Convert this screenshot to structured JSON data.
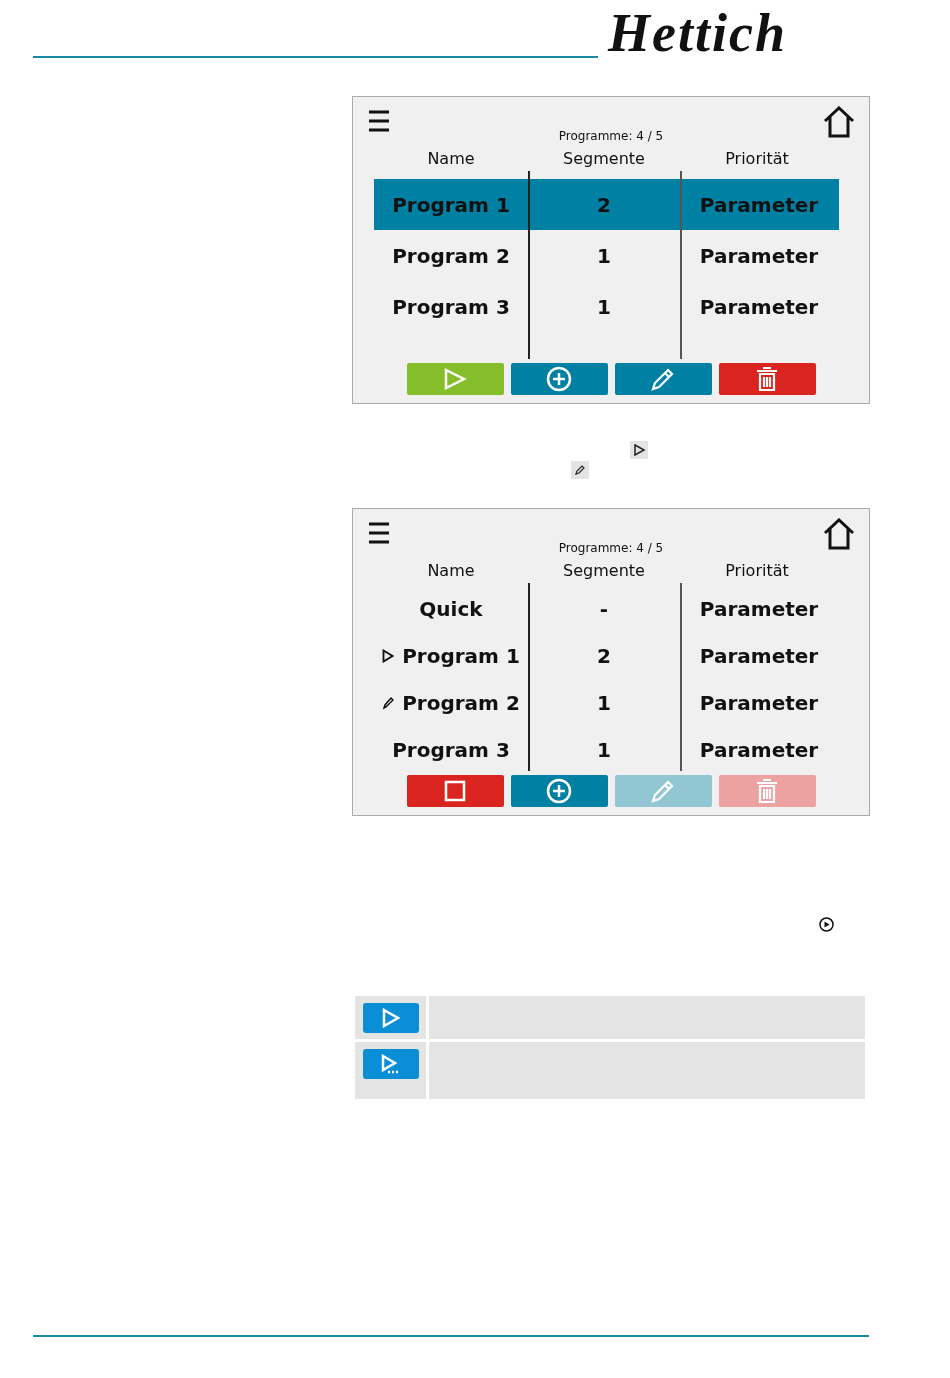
{
  "logo": "Hettich",
  "screens": [
    {
      "counter": "Programme: 4 / 5",
      "columns": [
        "Name",
        "Segmente",
        "Priorität"
      ],
      "rows": [
        {
          "name": "Program 1",
          "segments": "2",
          "priority": "Parameter",
          "selected": true,
          "running": false,
          "editing": false
        },
        {
          "name": "Program 2",
          "segments": "1",
          "priority": "Parameter",
          "selected": false,
          "running": false,
          "editing": false
        },
        {
          "name": "Program 3",
          "segments": "1",
          "priority": "Parameter",
          "selected": false,
          "running": false,
          "editing": false
        }
      ],
      "buttons": [
        {
          "kind": "play",
          "disabled": false
        },
        {
          "kind": "add",
          "disabled": false
        },
        {
          "kind": "edit",
          "disabled": false
        },
        {
          "kind": "delete",
          "disabled": false
        }
      ]
    },
    {
      "counter": "Programme: 4 / 5",
      "columns": [
        "Name",
        "Segmente",
        "Priorität"
      ],
      "rows": [
        {
          "name": "Quick",
          "segments": "-",
          "priority": "Parameter",
          "selected": false,
          "running": false,
          "editing": false
        },
        {
          "name": "Program 1",
          "segments": "2",
          "priority": "Parameter",
          "selected": false,
          "running": true,
          "editing": false
        },
        {
          "name": "Program 2",
          "segments": "1",
          "priority": "Parameter",
          "selected": false,
          "running": false,
          "editing": true
        },
        {
          "name": "Program 3",
          "segments": "1",
          "priority": "Parameter",
          "selected": false,
          "running": false,
          "editing": false
        }
      ],
      "buttons": [
        {
          "kind": "stop",
          "disabled": false
        },
        {
          "kind": "add",
          "disabled": false
        },
        {
          "kind": "edit",
          "disabled": true
        },
        {
          "kind": "delete",
          "disabled": true
        }
      ]
    }
  ]
}
